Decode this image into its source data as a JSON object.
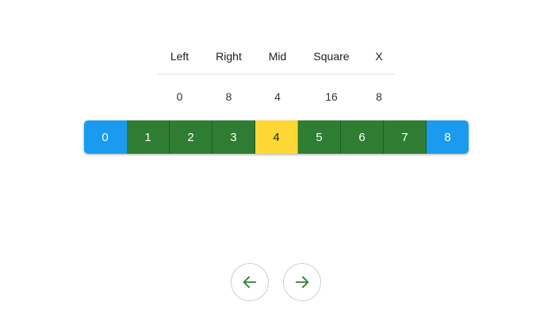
{
  "table": {
    "headers": {
      "left": "Left",
      "right": "Right",
      "mid": "Mid",
      "square": "Square",
      "x": "X"
    },
    "values": {
      "left": "0",
      "right": "8",
      "mid": "4",
      "square": "16",
      "x": "8"
    }
  },
  "array": {
    "cells": [
      {
        "value": "0",
        "state": "bound"
      },
      {
        "value": "1",
        "state": "inner"
      },
      {
        "value": "2",
        "state": "inner"
      },
      {
        "value": "3",
        "state": "inner"
      },
      {
        "value": "4",
        "state": "mid"
      },
      {
        "value": "5",
        "state": "inner"
      },
      {
        "value": "6",
        "state": "inner"
      },
      {
        "value": "7",
        "state": "inner"
      },
      {
        "value": "8",
        "state": "bound"
      }
    ]
  },
  "colors": {
    "bound": "#1a9bf0",
    "inner": "#2e7d32",
    "mid": "#fdd835",
    "arrow": "#2e7d32"
  },
  "nav": {
    "prev_icon": "arrow-left-icon",
    "next_icon": "arrow-right-icon"
  }
}
